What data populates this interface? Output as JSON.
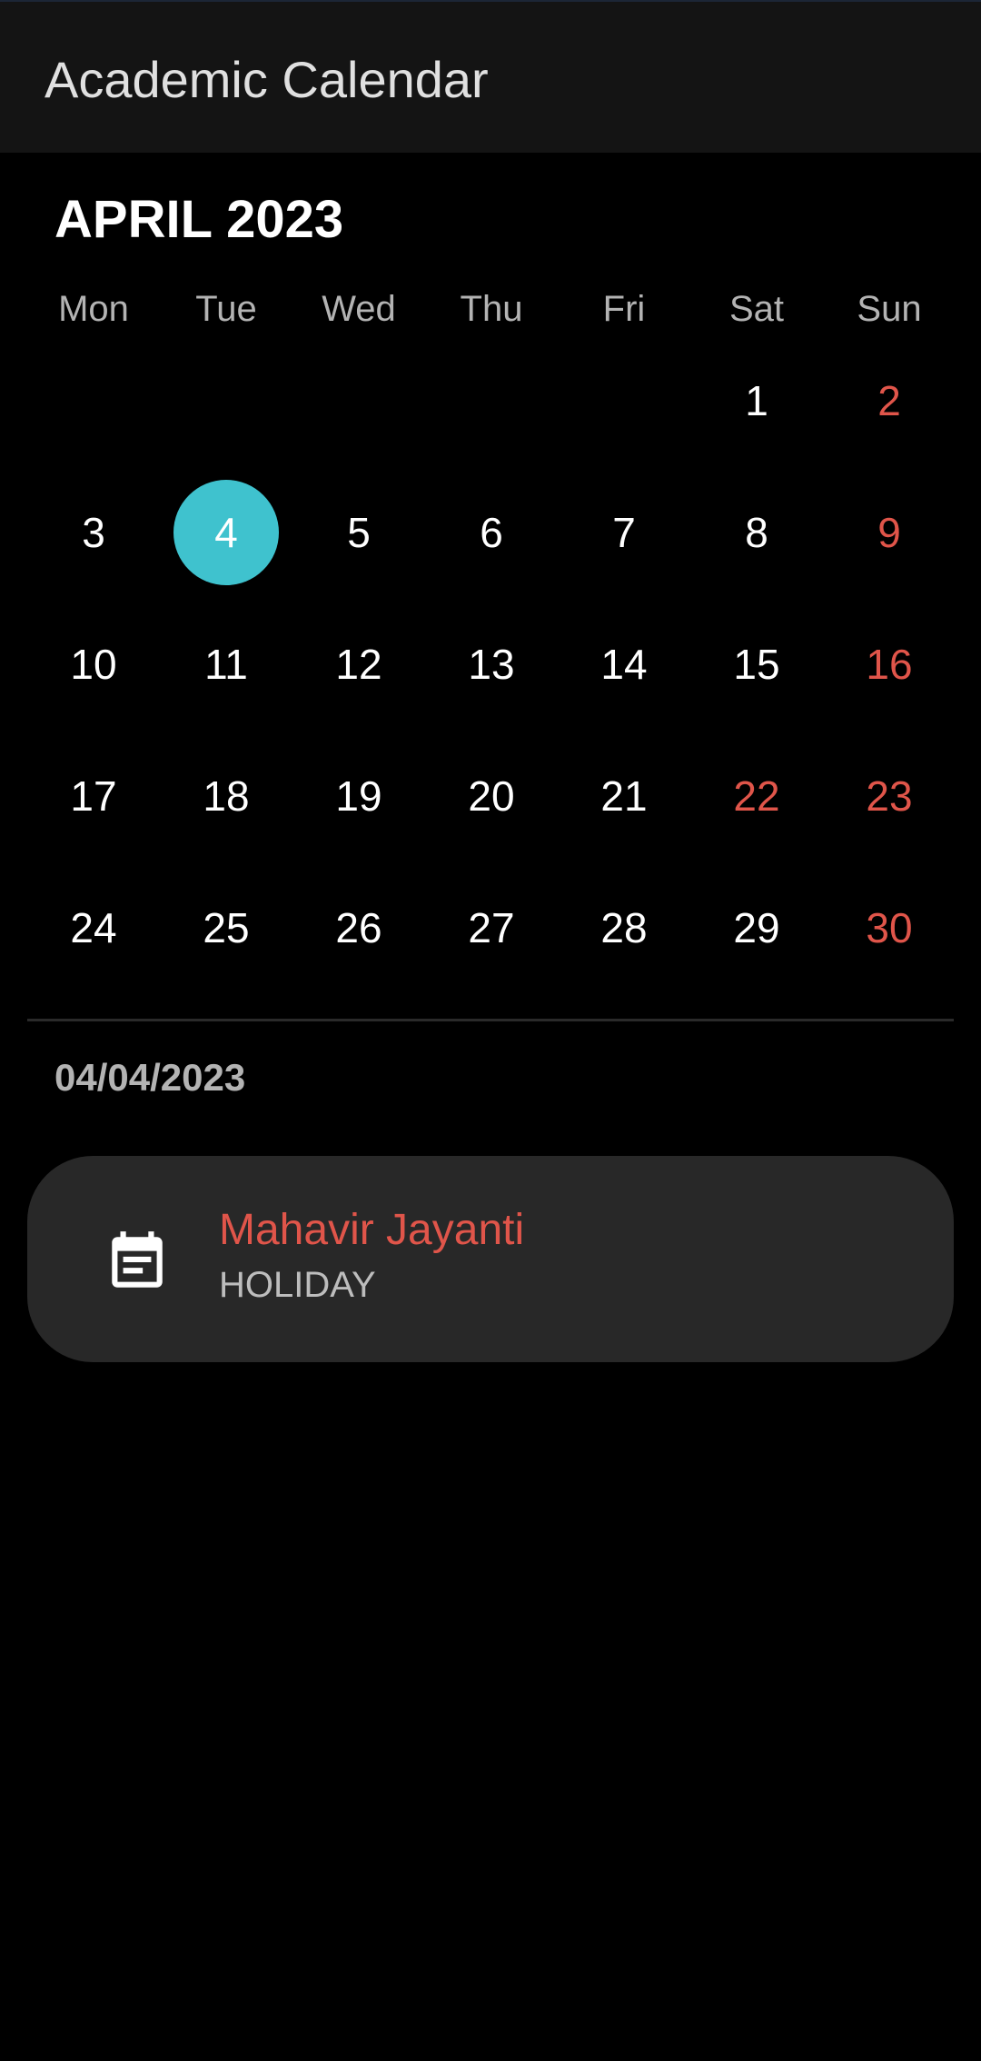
{
  "app": {
    "title": "Academic Calendar"
  },
  "calendar": {
    "month_title": "APRIL 2023",
    "weekdays": [
      "Mon",
      "Tue",
      "Wed",
      "Thu",
      "Fri",
      "Sat",
      "Sun"
    ],
    "first_weekday_index": 5,
    "days_in_month": 30,
    "selected_day": 4,
    "weekend_days": [
      2,
      9,
      16,
      22,
      23,
      30
    ]
  },
  "selected_date": "04/04/2023",
  "events": [
    {
      "title": "Mahavir Jayanti",
      "type": "HOLIDAY",
      "icon": "event-note-icon"
    }
  ],
  "colors": {
    "accent": "#3fc2ce",
    "holiday": "#e0554a",
    "background": "#000000",
    "app_bar": "#141414",
    "card": "#282828"
  }
}
